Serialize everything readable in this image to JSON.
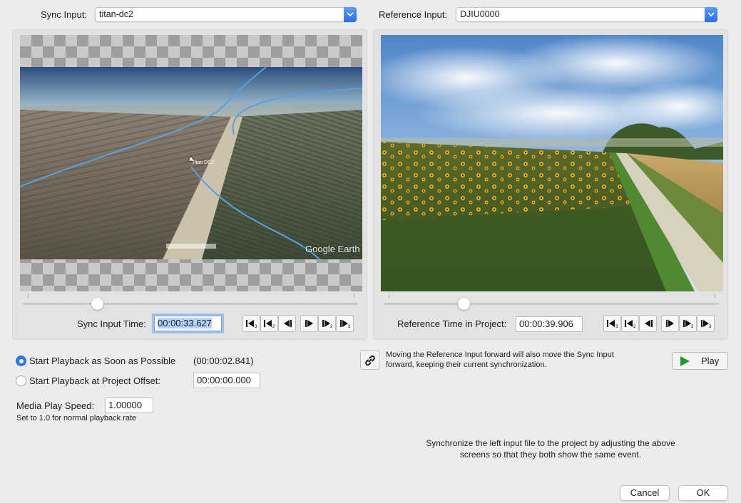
{
  "sync_input": {
    "label": "Sync Input:",
    "value": "titan-dc2"
  },
  "reference_input": {
    "label": "Reference Input:",
    "value": "DJIU0000"
  },
  "left_panel": {
    "overlay_label": "Titan DC2",
    "watermark": "Google Earth",
    "time_label": "Sync Input Time:",
    "time_value": "00:00:33.627",
    "slider_position": 0.22
  },
  "right_panel": {
    "time_label": "Reference Time in Project:",
    "time_value": "00:00:39.906",
    "slider_position": 0.24
  },
  "transport_buttons": {
    "left": [
      {
        "name": "step-back-3",
        "sub": "3"
      },
      {
        "name": "step-back-2",
        "sub": "2"
      },
      {
        "name": "step-back-1",
        "sub": ""
      },
      {
        "name": "step-forward-1",
        "sub": ""
      },
      {
        "name": "step-forward-2",
        "sub": "2"
      },
      {
        "name": "step-forward-3",
        "sub": "3"
      }
    ]
  },
  "playback": {
    "option_asap": "Start Playback as Soon as Possible",
    "asap_time": "(00:00:02.841)",
    "option_offset": "Start Playback at Project Offset:",
    "offset_value": "00:00:00.000",
    "selected": "asap"
  },
  "speed": {
    "label": "Media Play Speed:",
    "value": "1.00000",
    "hint": "Set to 1.0 for normal playback rate"
  },
  "link_note": "Moving the Reference Input forward will also move the Sync Input forward, keeping their current synchronization.",
  "play_label": "Play",
  "instructions": "Synchronize the left input file to the project by adjusting the above screens so that they both show the same event.",
  "cancel_label": "Cancel",
  "ok_label": "OK",
  "colors": {
    "accent": "#2d74e5",
    "play_icon": "#1f9a2b"
  }
}
